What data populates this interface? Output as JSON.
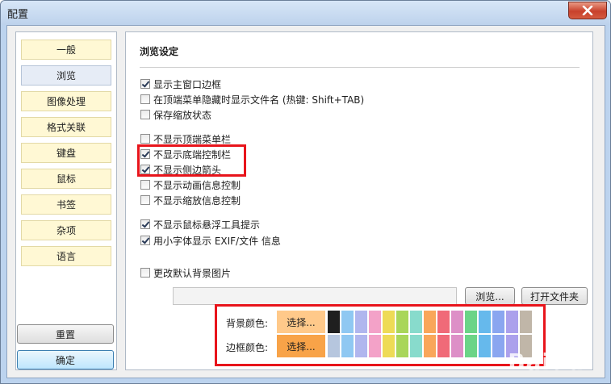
{
  "window": {
    "title": "配置"
  },
  "sidebar": {
    "items": [
      {
        "label": "一般",
        "selected": false
      },
      {
        "label": "浏览",
        "selected": true
      },
      {
        "label": "图像处理",
        "selected": false
      },
      {
        "label": "格式关联",
        "selected": false
      },
      {
        "label": "键盘",
        "selected": false
      },
      {
        "label": "鼠标",
        "selected": false
      },
      {
        "label": "书签",
        "selected": false
      },
      {
        "label": "杂项",
        "selected": false
      },
      {
        "label": "语言",
        "selected": false
      }
    ]
  },
  "footer": {
    "reset_label": "重置",
    "ok_label": "确定"
  },
  "panel": {
    "title": "浏览设定",
    "options": [
      {
        "label": "显示主窗口边框",
        "checked": true
      },
      {
        "label": "在顶端菜单隐藏时显示文件名 (热键: Shift+TAB)",
        "checked": false
      },
      {
        "label": "保存缩放状态",
        "checked": false
      },
      {
        "label": "不显示顶端菜单栏",
        "checked": false
      },
      {
        "label": "不显示底端控制栏",
        "checked": true
      },
      {
        "label": "不显示侧边箭头",
        "checked": true
      },
      {
        "label": "不显示动画信息控制",
        "checked": false
      },
      {
        "label": "不显示缩放信息控制",
        "checked": false
      },
      {
        "label": "不显示鼠标悬浮工具提示",
        "checked": true
      },
      {
        "label": "用小字体显示 EXIF/文件 信息",
        "checked": true
      },
      {
        "label": "更改默认背景图片",
        "checked": false
      }
    ],
    "background_image": {
      "path_value": "",
      "browse_label": "浏览...",
      "open_folder_label": "打开文件夹"
    },
    "colors": {
      "bg_label": "背景颜色:",
      "border_label": "边框颜色:",
      "choose_label": "选择...",
      "bg_choose_color": "#ffc98a",
      "border_choose_color": "#f8a348",
      "bg_swatches": [
        "#1f1f1f",
        "#8fc8f2",
        "#b0b6ee",
        "#f3a2c8",
        "#eedb56",
        "#a9d65a",
        "#88dbcc",
        "#f9a65a",
        "#f06a78",
        "#dd8fc7",
        "#6bd487",
        "#66b9ec",
        "#8aa6f0",
        "#aba0ec",
        "#c0b6a8"
      ],
      "border_swatches": [
        "#b6c6de",
        "#8fc8f2",
        "#b0b6ee",
        "#f3a2c8",
        "#eedb56",
        "#a9d65a",
        "#88dbcc",
        "#f9a65a",
        "#f06a78",
        "#dd8fc7",
        "#6bd487",
        "#66b9ec",
        "#8aa6f0",
        "#aba0ec",
        "#c0b6a8"
      ]
    }
  },
  "watermark": "Baidu"
}
